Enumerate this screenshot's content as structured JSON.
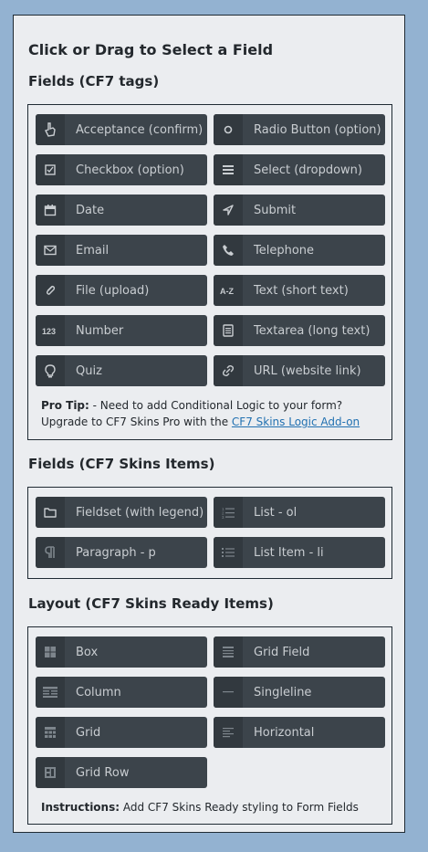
{
  "title": "Click or Drag to Select a Field",
  "sections": {
    "cf7_tags": {
      "heading": "Fields (CF7 tags)",
      "items": [
        {
          "label": "Acceptance (confirm)",
          "icon": "hand-icon"
        },
        {
          "label": "Radio Button (option)",
          "icon": "radio-icon"
        },
        {
          "label": "Checkbox (option)",
          "icon": "checkbox-icon"
        },
        {
          "label": "Select (dropdown)",
          "icon": "list-icon"
        },
        {
          "label": "Date",
          "icon": "calendar-icon"
        },
        {
          "label": "Submit",
          "icon": "send-icon"
        },
        {
          "label": "Email",
          "icon": "envelope-icon"
        },
        {
          "label": "Telephone",
          "icon": "phone-icon"
        },
        {
          "label": "File (upload)",
          "icon": "paperclip-icon"
        },
        {
          "label": "Text (short text)",
          "icon": "az-icon"
        },
        {
          "label": "Number",
          "icon": "number-icon"
        },
        {
          "label": "Textarea (long text)",
          "icon": "document-icon"
        },
        {
          "label": "Quiz",
          "icon": "lightbulb-icon"
        },
        {
          "label": "URL (website link)",
          "icon": "link-icon"
        }
      ],
      "tip_prefix": "Pro Tip:",
      "tip_line1": " - Need to add Conditional Logic to your form?",
      "tip_line2": "Upgrade to CF7 Skins Pro with the ",
      "tip_link": "CF7 Skins Logic Add-on"
    },
    "skins_items": {
      "heading": "Fields (CF7 Skins Items)",
      "items": [
        {
          "label": "Fieldset (with legend)",
          "icon": "folder-icon"
        },
        {
          "label": "List - ol",
          "icon": "ordered-list-icon"
        },
        {
          "label": "Paragraph - p",
          "icon": "paragraph-icon"
        },
        {
          "label": "List Item - li",
          "icon": "unordered-list-icon"
        }
      ]
    },
    "ready_items": {
      "heading": "Layout (CF7 Skins Ready Items)",
      "items": [
        {
          "label": "Box",
          "icon": "box-icon"
        },
        {
          "label": "Grid Field",
          "icon": "grid-field-icon"
        },
        {
          "label": "Column",
          "icon": "column-icon"
        },
        {
          "label": "Singleline",
          "icon": "singleline-icon"
        },
        {
          "label": "Grid",
          "icon": "grid-icon"
        },
        {
          "label": "Horizontal",
          "icon": "horizontal-icon"
        },
        {
          "label": "Grid Row",
          "icon": "grid-row-icon"
        }
      ],
      "instr_prefix": "Instructions:",
      "instr_text": " Add CF7 Skins Ready styling to Form Fields"
    }
  }
}
